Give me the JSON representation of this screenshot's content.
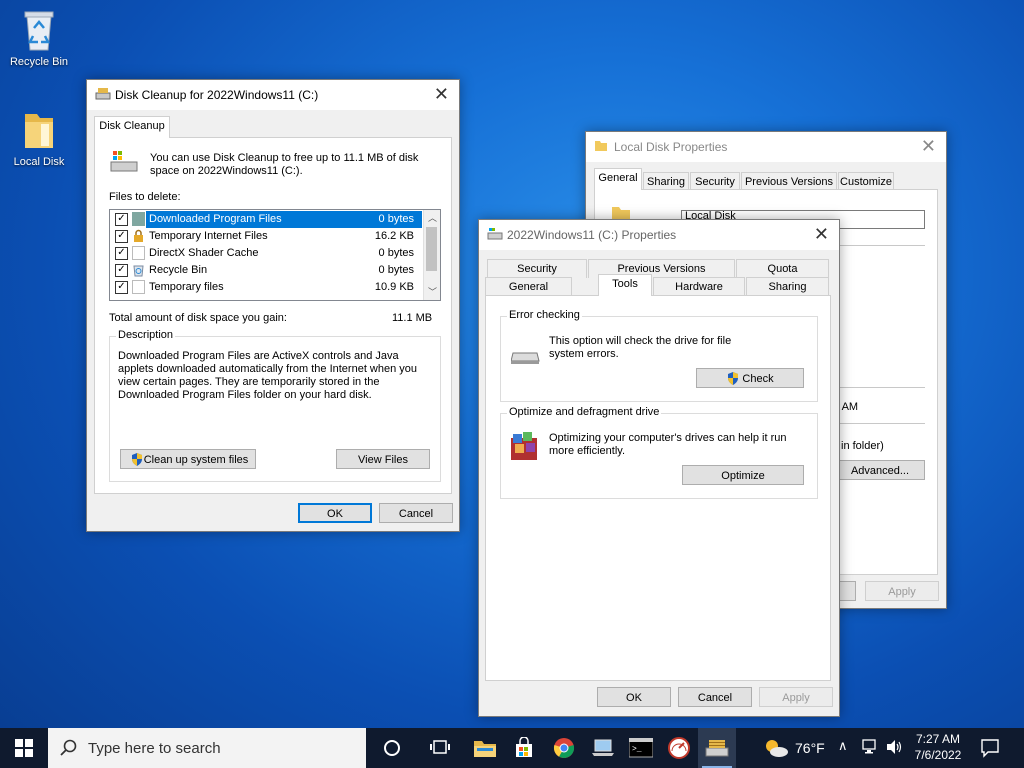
{
  "desktop": {
    "icons": [
      {
        "label": "Recycle Bin"
      },
      {
        "label": "Local Disk"
      }
    ]
  },
  "cleanup": {
    "title": "Disk Cleanup for 2022Windows11 (C:)",
    "tab": "Disk Cleanup",
    "intro": "You can use Disk Cleanup to free up to 11.1 MB of disk space on 2022Windows11 (C:).",
    "files_label": "Files to delete:",
    "files": [
      {
        "name": "Downloaded Program Files",
        "size": "0 bytes",
        "checked": true
      },
      {
        "name": "Temporary Internet Files",
        "size": "16.2 KB",
        "checked": true
      },
      {
        "name": "DirectX Shader Cache",
        "size": "0 bytes",
        "checked": true
      },
      {
        "name": "Recycle Bin",
        "size": "0 bytes",
        "checked": true
      },
      {
        "name": "Temporary files",
        "size": "10.9 KB",
        "checked": true
      }
    ],
    "total_label": "Total amount of disk space you gain:",
    "total_value": "11.1 MB",
    "description_label": "Description",
    "description": "Downloaded Program Files are ActiveX controls and Java applets downloaded automatically from the Internet when you view certain pages. They are temporarily stored in the Downloaded Program Files folder on your hard disk.",
    "cleanup_system_btn": "Clean up system files",
    "view_files_btn": "View Files",
    "ok": "OK",
    "cancel": "Cancel"
  },
  "localdisk": {
    "title": "Local Disk Properties",
    "tabs": [
      "General",
      "Sharing",
      "Security",
      "Previous Versions",
      "Customize"
    ],
    "name_value": "Local Disk",
    "partial_time": "0 AM",
    "partial_folder": "in folder)",
    "advanced_btn": "Advanced...",
    "apply": "Apply"
  },
  "props": {
    "title": "2022Windows11 (C:) Properties",
    "tabs_row1": [
      "Security",
      "Previous Versions",
      "Quota"
    ],
    "tabs_row2": [
      "General",
      "Tools",
      "Hardware",
      "Sharing"
    ],
    "error_group": "Error checking",
    "error_text": "This option will check the drive for file system errors.",
    "check_btn": "Check",
    "opt_group": "Optimize and defragment drive",
    "opt_text": "Optimizing your computer's drives can help it run more efficiently.",
    "optimize_btn": "Optimize",
    "ok": "OK",
    "cancel": "Cancel",
    "apply": "Apply"
  },
  "taskbar": {
    "search_placeholder": "Type here to search",
    "weather": "76°F",
    "time": "7:27 AM",
    "date": "7/6/2022"
  },
  "colors": {
    "accent": "#0078d7",
    "taskbar": "#0f1a2e"
  }
}
